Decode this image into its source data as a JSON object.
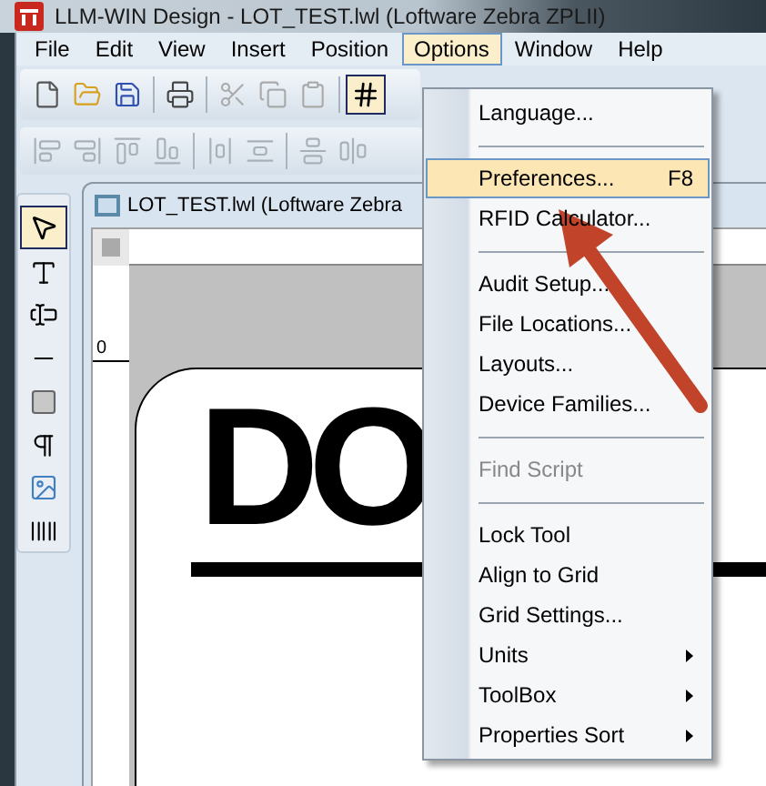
{
  "window": {
    "title": "LLM-WIN Design - LOT_TEST.lwl (Loftware Zebra ZPLII)"
  },
  "menu_bar": [
    {
      "label": "File",
      "selected": false
    },
    {
      "label": "Edit",
      "selected": false
    },
    {
      "label": "View",
      "selected": false
    },
    {
      "label": "Insert",
      "selected": false
    },
    {
      "label": "Position",
      "selected": false
    },
    {
      "label": "Options",
      "selected": true
    },
    {
      "label": "Window",
      "selected": false
    },
    {
      "label": "Help",
      "selected": false
    }
  ],
  "document": {
    "title": "LOT_TEST.lwl (Loftware Zebra",
    "ruler_label": "0",
    "label_text": "DO"
  },
  "options_menu": [
    {
      "kind": "item",
      "label": "Language...",
      "selected": false,
      "disabled": false
    },
    {
      "kind": "separator"
    },
    {
      "kind": "item",
      "label": "Preferences...",
      "shortcut": "F8",
      "selected": true,
      "disabled": false
    },
    {
      "kind": "item",
      "label": "RFID Calculator...",
      "selected": false,
      "disabled": false
    },
    {
      "kind": "separator"
    },
    {
      "kind": "item",
      "label": "Audit Setup...",
      "selected": false,
      "disabled": false
    },
    {
      "kind": "item",
      "label": "File Locations...",
      "selected": false,
      "disabled": false
    },
    {
      "kind": "item",
      "label": "Layouts...",
      "selected": false,
      "disabled": false
    },
    {
      "kind": "item",
      "label": "Device Families...",
      "selected": false,
      "disabled": false
    },
    {
      "kind": "separator"
    },
    {
      "kind": "item",
      "label": "Find Script",
      "selected": false,
      "disabled": true
    },
    {
      "kind": "separator"
    },
    {
      "kind": "item",
      "label": "Lock Tool",
      "selected": false,
      "disabled": false
    },
    {
      "kind": "item",
      "label": "Align to Grid",
      "selected": false,
      "disabled": false
    },
    {
      "kind": "item",
      "label": "Grid Settings...",
      "selected": false,
      "disabled": false
    },
    {
      "kind": "submenu",
      "label": "Units",
      "selected": false,
      "disabled": false
    },
    {
      "kind": "submenu",
      "label": "ToolBox",
      "selected": false,
      "disabled": false
    },
    {
      "kind": "submenu",
      "label": "Properties Sort",
      "selected": false,
      "disabled": false
    }
  ]
}
